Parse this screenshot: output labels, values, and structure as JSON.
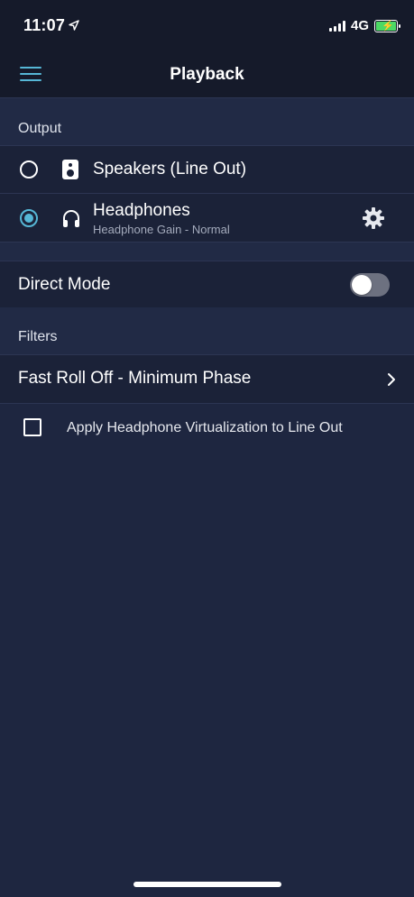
{
  "status_bar": {
    "time": "11:07",
    "network": "4G"
  },
  "nav": {
    "title": "Playback",
    "menu_icon": "hamburger-menu-icon"
  },
  "output_section": {
    "header": "Output",
    "options": [
      {
        "label": "Speakers (Line Out)",
        "icon": "speaker-icon",
        "selected": false
      },
      {
        "label": "Headphones",
        "subtitle": "Headphone Gain - Normal",
        "icon": "headphones-icon",
        "selected": true
      }
    ]
  },
  "direct_mode": {
    "label": "Direct Mode",
    "enabled": false
  },
  "filters_section": {
    "header": "Filters",
    "selected_filter": "Fast Roll Off - Minimum Phase"
  },
  "virtualization": {
    "label": "Apply Headphone Virtualization to Line Out",
    "checked": false
  },
  "colors": {
    "background": "#1e2640",
    "row": "#1b2238",
    "accent": "#56b7d6",
    "toggle_off": "#6d7180"
  }
}
